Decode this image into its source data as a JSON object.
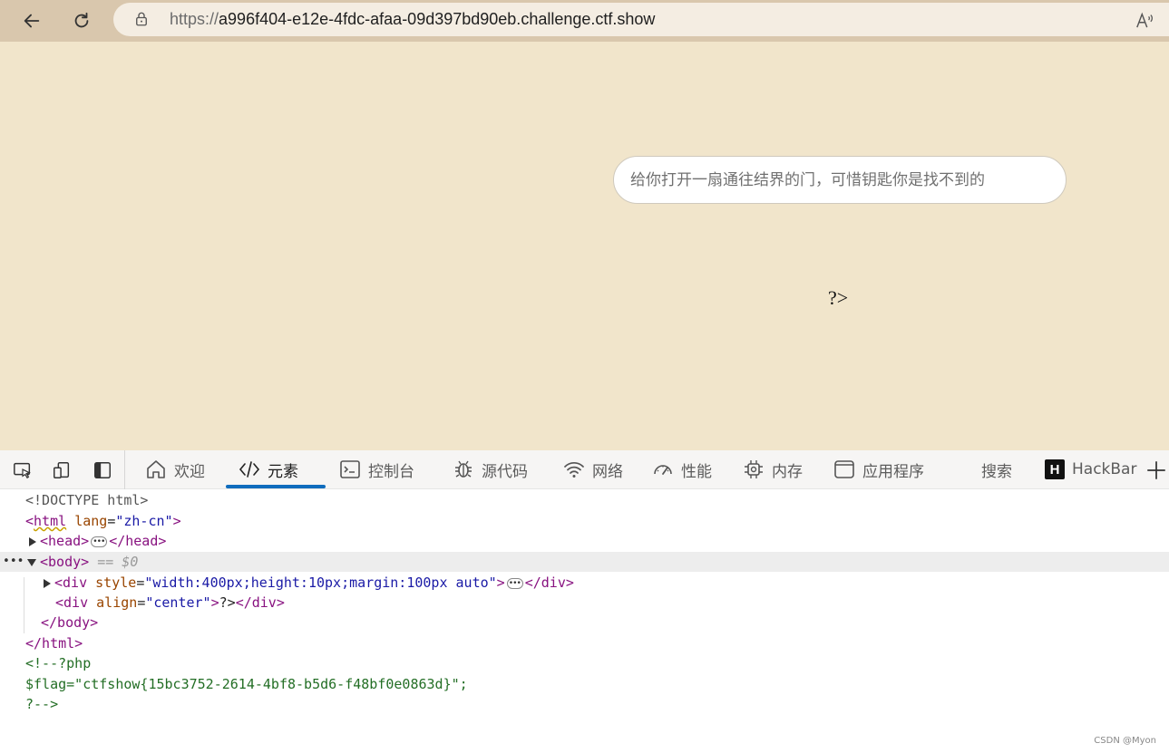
{
  "browser": {
    "url_protocol": "https://",
    "url_host": "a996f404-e12e-4fdc-afaa-09d397bd90eb.challenge.ctf.show"
  },
  "page": {
    "input_placeholder": "给你打开一扇通往结界的门，可惜钥匙你是找不到的",
    "php_close_text": "?>"
  },
  "devtools": {
    "tabs": [
      {
        "label": "欢迎",
        "icon": "home-icon"
      },
      {
        "label": "元素",
        "icon": "code-icon"
      },
      {
        "label": "控制台",
        "icon": "console-icon"
      },
      {
        "label": "源代码",
        "icon": "bug-icon"
      },
      {
        "label": "网络",
        "icon": "wifi-icon"
      },
      {
        "label": "性能",
        "icon": "gauge-icon"
      },
      {
        "label": "内存",
        "icon": "chip-icon"
      },
      {
        "label": "应用程序",
        "icon": "app-icon"
      },
      {
        "label": "搜索",
        "icon": ""
      },
      {
        "label": "HackBar",
        "icon": "hackbar-logo"
      }
    ],
    "active_tab": "元素",
    "hackbar_logo_letter": "H",
    "tree": {
      "doctype": "<!DOCTYPE html>",
      "html_open_tag": "html",
      "html_lang_attr": "lang",
      "html_lang_val": "\"zh-cn\"",
      "head_tag": "head",
      "body_tag": "body",
      "body_ref": "== $0",
      "div1_tag": "div",
      "div1_attr": "style",
      "div1_val": "\"width:400px;height:10px;margin:100px auto\"",
      "div2_tag": "div",
      "div2_attr": "align",
      "div2_val": "\"center\"",
      "div2_text": "?>",
      "body_close": "</body>",
      "html_close": "</html>",
      "comment_line1": "<!--?php",
      "comment_line2": "$flag=\"ctfshow{15bc3752-2614-4bf8-b5d6-f48bf0e0863d}\";",
      "comment_line3": "?-->"
    }
  },
  "watermark": "CSDN @Myon⁠"
}
